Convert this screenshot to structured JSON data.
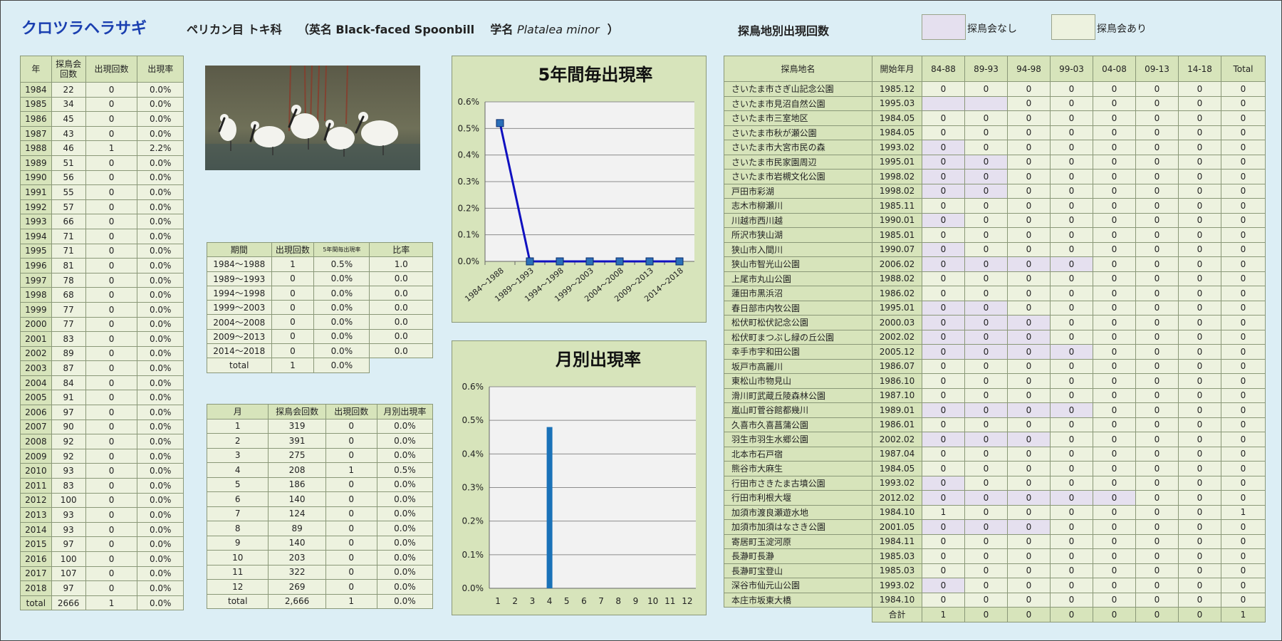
{
  "header": {
    "species": "クロツラヘラサギ",
    "order_family": "ペリカン目 トキ科",
    "en_label": "（英名 Black-faced Spoonbill",
    "sci_label": "学名",
    "sci_name": "Platalea minor",
    "close_paren": "）",
    "site_title": "探鳥地別出現回数",
    "legend_none": "探鳥会なし",
    "legend_yes": "探鳥会あり"
  },
  "colors": {
    "header_fill": "#d7e4bb",
    "data_fill": "#edf2df",
    "no_meeting_fill": "#e5e0ef",
    "line_color": "#1010c0",
    "marker_color": "#2a6fb8",
    "bar_color": "#1a72b8"
  },
  "year_table": {
    "headers": [
      "年",
      "探鳥会回数",
      "出現回数",
      "出現率"
    ],
    "rows": [
      [
        "1984",
        "22",
        "0",
        "0.0%"
      ],
      [
        "1985",
        "34",
        "0",
        "0.0%"
      ],
      [
        "1986",
        "45",
        "0",
        "0.0%"
      ],
      [
        "1987",
        "43",
        "0",
        "0.0%"
      ],
      [
        "1988",
        "46",
        "1",
        "2.2%"
      ],
      [
        "1989",
        "51",
        "0",
        "0.0%"
      ],
      [
        "1990",
        "56",
        "0",
        "0.0%"
      ],
      [
        "1991",
        "55",
        "0",
        "0.0%"
      ],
      [
        "1992",
        "57",
        "0",
        "0.0%"
      ],
      [
        "1993",
        "66",
        "0",
        "0.0%"
      ],
      [
        "1994",
        "71",
        "0",
        "0.0%"
      ],
      [
        "1995",
        "71",
        "0",
        "0.0%"
      ],
      [
        "1996",
        "81",
        "0",
        "0.0%"
      ],
      [
        "1997",
        "78",
        "0",
        "0.0%"
      ],
      [
        "1998",
        "68",
        "0",
        "0.0%"
      ],
      [
        "1999",
        "77",
        "0",
        "0.0%"
      ],
      [
        "2000",
        "77",
        "0",
        "0.0%"
      ],
      [
        "2001",
        "83",
        "0",
        "0.0%"
      ],
      [
        "2002",
        "89",
        "0",
        "0.0%"
      ],
      [
        "2003",
        "87",
        "0",
        "0.0%"
      ],
      [
        "2004",
        "84",
        "0",
        "0.0%"
      ],
      [
        "2005",
        "91",
        "0",
        "0.0%"
      ],
      [
        "2006",
        "97",
        "0",
        "0.0%"
      ],
      [
        "2007",
        "90",
        "0",
        "0.0%"
      ],
      [
        "2008",
        "92",
        "0",
        "0.0%"
      ],
      [
        "2009",
        "92",
        "0",
        "0.0%"
      ],
      [
        "2010",
        "93",
        "0",
        "0.0%"
      ],
      [
        "2011",
        "83",
        "0",
        "0.0%"
      ],
      [
        "2012",
        "100",
        "0",
        "0.0%"
      ],
      [
        "2013",
        "93",
        "0",
        "0.0%"
      ],
      [
        "2014",
        "93",
        "0",
        "0.0%"
      ],
      [
        "2015",
        "97",
        "0",
        "0.0%"
      ],
      [
        "2016",
        "100",
        "0",
        "0.0%"
      ],
      [
        "2017",
        "107",
        "0",
        "0.0%"
      ],
      [
        "2018",
        "97",
        "0",
        "0.0%"
      ],
      [
        "total",
        "2666",
        "1",
        "0.0%"
      ]
    ]
  },
  "period_table": {
    "headers": [
      "期間",
      "出現回数",
      "5年間毎出現率",
      "比率"
    ],
    "rows": [
      [
        "1984～1988",
        "1",
        "0.5%",
        "1.0"
      ],
      [
        "1989～1993",
        "0",
        "0.0%",
        "0.0"
      ],
      [
        "1994～1998",
        "0",
        "0.0%",
        "0.0"
      ],
      [
        "1999～2003",
        "0",
        "0.0%",
        "0.0"
      ],
      [
        "2004～2008",
        "0",
        "0.0%",
        "0.0"
      ],
      [
        "2009～2013",
        "0",
        "0.0%",
        "0.0"
      ],
      [
        "2014～2018",
        "0",
        "0.0%",
        "0.0"
      ]
    ],
    "total": [
      "total",
      "1",
      "0.0%"
    ]
  },
  "month_table": {
    "headers": [
      "月",
      "探鳥会回数",
      "出現回数",
      "月別出現率"
    ],
    "rows": [
      [
        "1",
        "319",
        "0",
        "0.0%"
      ],
      [
        "2",
        "391",
        "0",
        "0.0%"
      ],
      [
        "3",
        "275",
        "0",
        "0.0%"
      ],
      [
        "4",
        "208",
        "1",
        "0.5%"
      ],
      [
        "5",
        "186",
        "0",
        "0.0%"
      ],
      [
        "6",
        "140",
        "0",
        "0.0%"
      ],
      [
        "7",
        "124",
        "0",
        "0.0%"
      ],
      [
        "8",
        "89",
        "0",
        "0.0%"
      ],
      [
        "9",
        "140",
        "0",
        "0.0%"
      ],
      [
        "10",
        "203",
        "0",
        "0.0%"
      ],
      [
        "11",
        "322",
        "0",
        "0.0%"
      ],
      [
        "12",
        "269",
        "0",
        "0.0%"
      ],
      [
        "total",
        "2,666",
        "1",
        "0.0%"
      ]
    ]
  },
  "site_table": {
    "headers": [
      "探鳥地名",
      "開始年月",
      "84-88",
      "89-93",
      "94-98",
      "99-03",
      "04-08",
      "09-13",
      "14-18",
      "Total"
    ],
    "rows": [
      {
        "name": "さいたま市さぎ山記念公園",
        "start": "1985.12",
        "vals": [
          "0",
          "0",
          "0",
          "0",
          "0",
          "0",
          "0",
          "0"
        ],
        "none": []
      },
      {
        "name": "さいたま市見沼自然公園",
        "start": "1995.03",
        "vals": [
          "",
          "",
          "0",
          "0",
          "0",
          "0",
          "0",
          "0"
        ],
        "none": [
          0,
          1
        ]
      },
      {
        "name": "さいたま市三室地区",
        "start": "1984.05",
        "vals": [
          "0",
          "0",
          "0",
          "0",
          "0",
          "0",
          "0",
          "0"
        ],
        "none": []
      },
      {
        "name": "さいたま市秋が瀬公園",
        "start": "1984.05",
        "vals": [
          "0",
          "0",
          "0",
          "0",
          "0",
          "0",
          "0",
          "0"
        ],
        "none": []
      },
      {
        "name": "さいたま市大宮市民の森",
        "start": "1993.02",
        "vals": [
          "0",
          "0",
          "0",
          "0",
          "0",
          "0",
          "0",
          "0"
        ],
        "none": [
          0
        ]
      },
      {
        "name": "さいたま市民家園周辺",
        "start": "1995.01",
        "vals": [
          "0",
          "0",
          "0",
          "0",
          "0",
          "0",
          "0",
          "0"
        ],
        "none": [
          0,
          1
        ]
      },
      {
        "name": "さいたま市岩槻文化公園",
        "start": "1998.02",
        "vals": [
          "0",
          "0",
          "0",
          "0",
          "0",
          "0",
          "0",
          "0"
        ],
        "none": [
          0,
          1
        ]
      },
      {
        "name": "戸田市彩湖",
        "start": "1998.02",
        "vals": [
          "0",
          "0",
          "0",
          "0",
          "0",
          "0",
          "0",
          "0"
        ],
        "none": [
          0,
          1
        ]
      },
      {
        "name": "志木市柳瀬川",
        "start": "1985.11",
        "vals": [
          "0",
          "0",
          "0",
          "0",
          "0",
          "0",
          "0",
          "0"
        ],
        "none": []
      },
      {
        "name": "川越市西川越",
        "start": "1990.01",
        "vals": [
          "0",
          "0",
          "0",
          "0",
          "0",
          "0",
          "0",
          "0"
        ],
        "none": [
          0
        ]
      },
      {
        "name": "所沢市狭山湖",
        "start": "1985.01",
        "vals": [
          "0",
          "0",
          "0",
          "0",
          "0",
          "0",
          "0",
          "0"
        ],
        "none": []
      },
      {
        "name": "狭山市入間川",
        "start": "1990.07",
        "vals": [
          "0",
          "0",
          "0",
          "0",
          "0",
          "0",
          "0",
          "0"
        ],
        "none": [
          0
        ]
      },
      {
        "name": "狭山市智光山公園",
        "start": "2006.02",
        "vals": [
          "0",
          "0",
          "0",
          "0",
          "0",
          "0",
          "0",
          "0"
        ],
        "none": [
          0,
          1,
          2,
          3
        ]
      },
      {
        "name": "上尾市丸山公園",
        "start": "1988.02",
        "vals": [
          "0",
          "0",
          "0",
          "0",
          "0",
          "0",
          "0",
          "0"
        ],
        "none": []
      },
      {
        "name": "蓮田市黒浜沼",
        "start": "1986.02",
        "vals": [
          "0",
          "0",
          "0",
          "0",
          "0",
          "0",
          "0",
          "0"
        ],
        "none": []
      },
      {
        "name": "春日部市内牧公園",
        "start": "1995.01",
        "vals": [
          "0",
          "0",
          "0",
          "0",
          "0",
          "0",
          "0",
          "0"
        ],
        "none": [
          0,
          1
        ]
      },
      {
        "name": "松伏町松伏記念公園",
        "start": "2000.03",
        "vals": [
          "0",
          "0",
          "0",
          "0",
          "0",
          "0",
          "0",
          "0"
        ],
        "none": [
          0,
          1,
          2
        ]
      },
      {
        "name": "松伏町まつぶし緑の丘公園",
        "start": "2002.02",
        "vals": [
          "0",
          "0",
          "0",
          "0",
          "0",
          "0",
          "0",
          "0"
        ],
        "none": [
          0,
          1,
          2
        ]
      },
      {
        "name": "幸手市宇和田公園",
        "start": "2005.12",
        "vals": [
          "0",
          "0",
          "0",
          "0",
          "0",
          "0",
          "0",
          "0"
        ],
        "none": [
          0,
          1,
          2,
          3
        ]
      },
      {
        "name": "坂戸市高麗川",
        "start": "1986.07",
        "vals": [
          "0",
          "0",
          "0",
          "0",
          "0",
          "0",
          "0",
          "0"
        ],
        "none": []
      },
      {
        "name": "東松山市物見山",
        "start": "1986.10",
        "vals": [
          "0",
          "0",
          "0",
          "0",
          "0",
          "0",
          "0",
          "0"
        ],
        "none": []
      },
      {
        "name": "滑川町武蔵丘陵森林公園",
        "start": "1987.10",
        "vals": [
          "0",
          "0",
          "0",
          "0",
          "0",
          "0",
          "0",
          "0"
        ],
        "none": []
      },
      {
        "name": "嵐山町菅谷館都幾川",
        "start": "1989.01",
        "vals": [
          "0",
          "0",
          "0",
          "0",
          "0",
          "0",
          "0",
          "0"
        ],
        "none": [
          0,
          1,
          2,
          3
        ]
      },
      {
        "name": "久喜市久喜菖蒲公園",
        "start": "1986.01",
        "vals": [
          "0",
          "0",
          "0",
          "0",
          "0",
          "0",
          "0",
          "0"
        ],
        "none": []
      },
      {
        "name": "羽生市羽生水郷公園",
        "start": "2002.02",
        "vals": [
          "0",
          "0",
          "0",
          "0",
          "0",
          "0",
          "0",
          "0"
        ],
        "none": [
          0,
          1,
          2
        ]
      },
      {
        "name": "北本市石戸宿",
        "start": "1987.04",
        "vals": [
          "0",
          "0",
          "0",
          "0",
          "0",
          "0",
          "0",
          "0"
        ],
        "none": []
      },
      {
        "name": "熊谷市大麻生",
        "start": "1984.05",
        "vals": [
          "0",
          "0",
          "0",
          "0",
          "0",
          "0",
          "0",
          "0"
        ],
        "none": []
      },
      {
        "name": "行田市さきたま古墳公園",
        "start": "1993.02",
        "vals": [
          "0",
          "0",
          "0",
          "0",
          "0",
          "0",
          "0",
          "0"
        ],
        "none": [
          0
        ]
      },
      {
        "name": "行田市利根大堰",
        "start": "2012.02",
        "vals": [
          "0",
          "0",
          "0",
          "0",
          "0",
          "0",
          "0",
          "0"
        ],
        "none": [
          0,
          1,
          2,
          3,
          4
        ]
      },
      {
        "name": "加須市渡良瀬遊水地",
        "start": "1984.10",
        "vals": [
          "1",
          "0",
          "0",
          "0",
          "0",
          "0",
          "0",
          "1"
        ],
        "none": []
      },
      {
        "name": "加須市加須はなさき公園",
        "start": "2001.05",
        "vals": [
          "0",
          "0",
          "0",
          "0",
          "0",
          "0",
          "0",
          "0"
        ],
        "none": [
          0,
          1,
          2
        ]
      },
      {
        "name": "寄居町玉淀河原",
        "start": "1984.11",
        "vals": [
          "0",
          "0",
          "0",
          "0",
          "0",
          "0",
          "0",
          "0"
        ],
        "none": []
      },
      {
        "name": "長瀞町長瀞",
        "start": "1985.03",
        "vals": [
          "0",
          "0",
          "0",
          "0",
          "0",
          "0",
          "0",
          "0"
        ],
        "none": []
      },
      {
        "name": "長瀞町宝登山",
        "start": "1985.03",
        "vals": [
          "0",
          "0",
          "0",
          "0",
          "0",
          "0",
          "0",
          "0"
        ],
        "none": []
      },
      {
        "name": "深谷市仙元山公園",
        "start": "1993.02",
        "vals": [
          "0",
          "0",
          "0",
          "0",
          "0",
          "0",
          "0",
          "0"
        ],
        "none": [
          0
        ]
      },
      {
        "name": "本庄市坂東大橋",
        "start": "1984.10",
        "vals": [
          "0",
          "0",
          "0",
          "0",
          "0",
          "0",
          "0",
          "0"
        ],
        "none": []
      }
    ],
    "total_label": "合計",
    "totals": [
      "1",
      "0",
      "0",
      "0",
      "0",
      "0",
      "0",
      "1"
    ]
  },
  "chart_data": [
    {
      "type": "line",
      "title": "5年間毎出現率",
      "categories": [
        "1984～1988",
        "1989～1993",
        "1994～1998",
        "1999～2003",
        "2004～2008",
        "2009～2013",
        "2014～2018"
      ],
      "values": [
        0.52,
        0,
        0,
        0,
        0,
        0,
        0
      ],
      "ylim": [
        0,
        0.6
      ],
      "yticks": [
        "0.0%",
        "0.1%",
        "0.2%",
        "0.3%",
        "0.4%",
        "0.5%",
        "0.6%"
      ],
      "grid": true,
      "xlabel": "",
      "ylabel": ""
    },
    {
      "type": "bar",
      "title": "月別出現率",
      "categories": [
        "1",
        "2",
        "3",
        "4",
        "5",
        "6",
        "7",
        "8",
        "9",
        "10",
        "11",
        "12"
      ],
      "values": [
        0,
        0,
        0,
        0.48,
        0,
        0,
        0,
        0,
        0,
        0,
        0,
        0
      ],
      "ylim": [
        0,
        0.6
      ],
      "yticks": [
        "0.0%",
        "0.1%",
        "0.2%",
        "0.3%",
        "0.4%",
        "0.5%",
        "0.6%"
      ],
      "grid": true,
      "xlabel": "",
      "ylabel": ""
    }
  ]
}
